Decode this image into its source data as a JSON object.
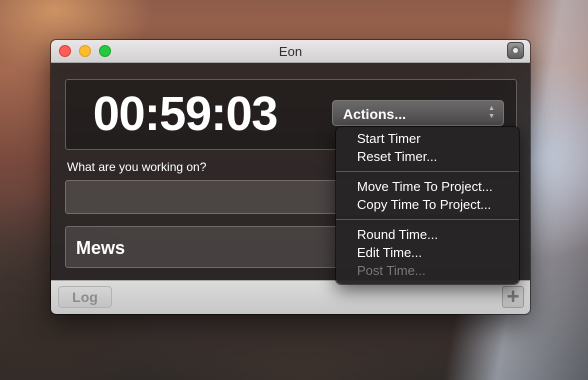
{
  "window": {
    "title": "Eon"
  },
  "timer": {
    "display": "00:59:03"
  },
  "actions": {
    "label": "Actions..."
  },
  "prompt": {
    "label": "What are you working on?",
    "input_value": ""
  },
  "project": {
    "label": "Mews"
  },
  "footer": {
    "log_label": "Log",
    "add_label": "+"
  },
  "menu": {
    "items": [
      {
        "label": "Start Timer",
        "enabled": true
      },
      {
        "label": "Reset Timer...",
        "enabled": true
      },
      {
        "label": "Move Time To Project...",
        "enabled": true
      },
      {
        "label": "Copy Time To Project...",
        "enabled": true
      },
      {
        "label": "Round Time...",
        "enabled": true
      },
      {
        "label": "Edit Time...",
        "enabled": true
      },
      {
        "label": "Post Time...",
        "enabled": false
      }
    ]
  },
  "icons": {
    "close": "close-icon",
    "minimize": "minimize-icon",
    "maximize": "maximize-icon",
    "camera": "camera-icon",
    "updown": "updown-arrows-icon"
  }
}
